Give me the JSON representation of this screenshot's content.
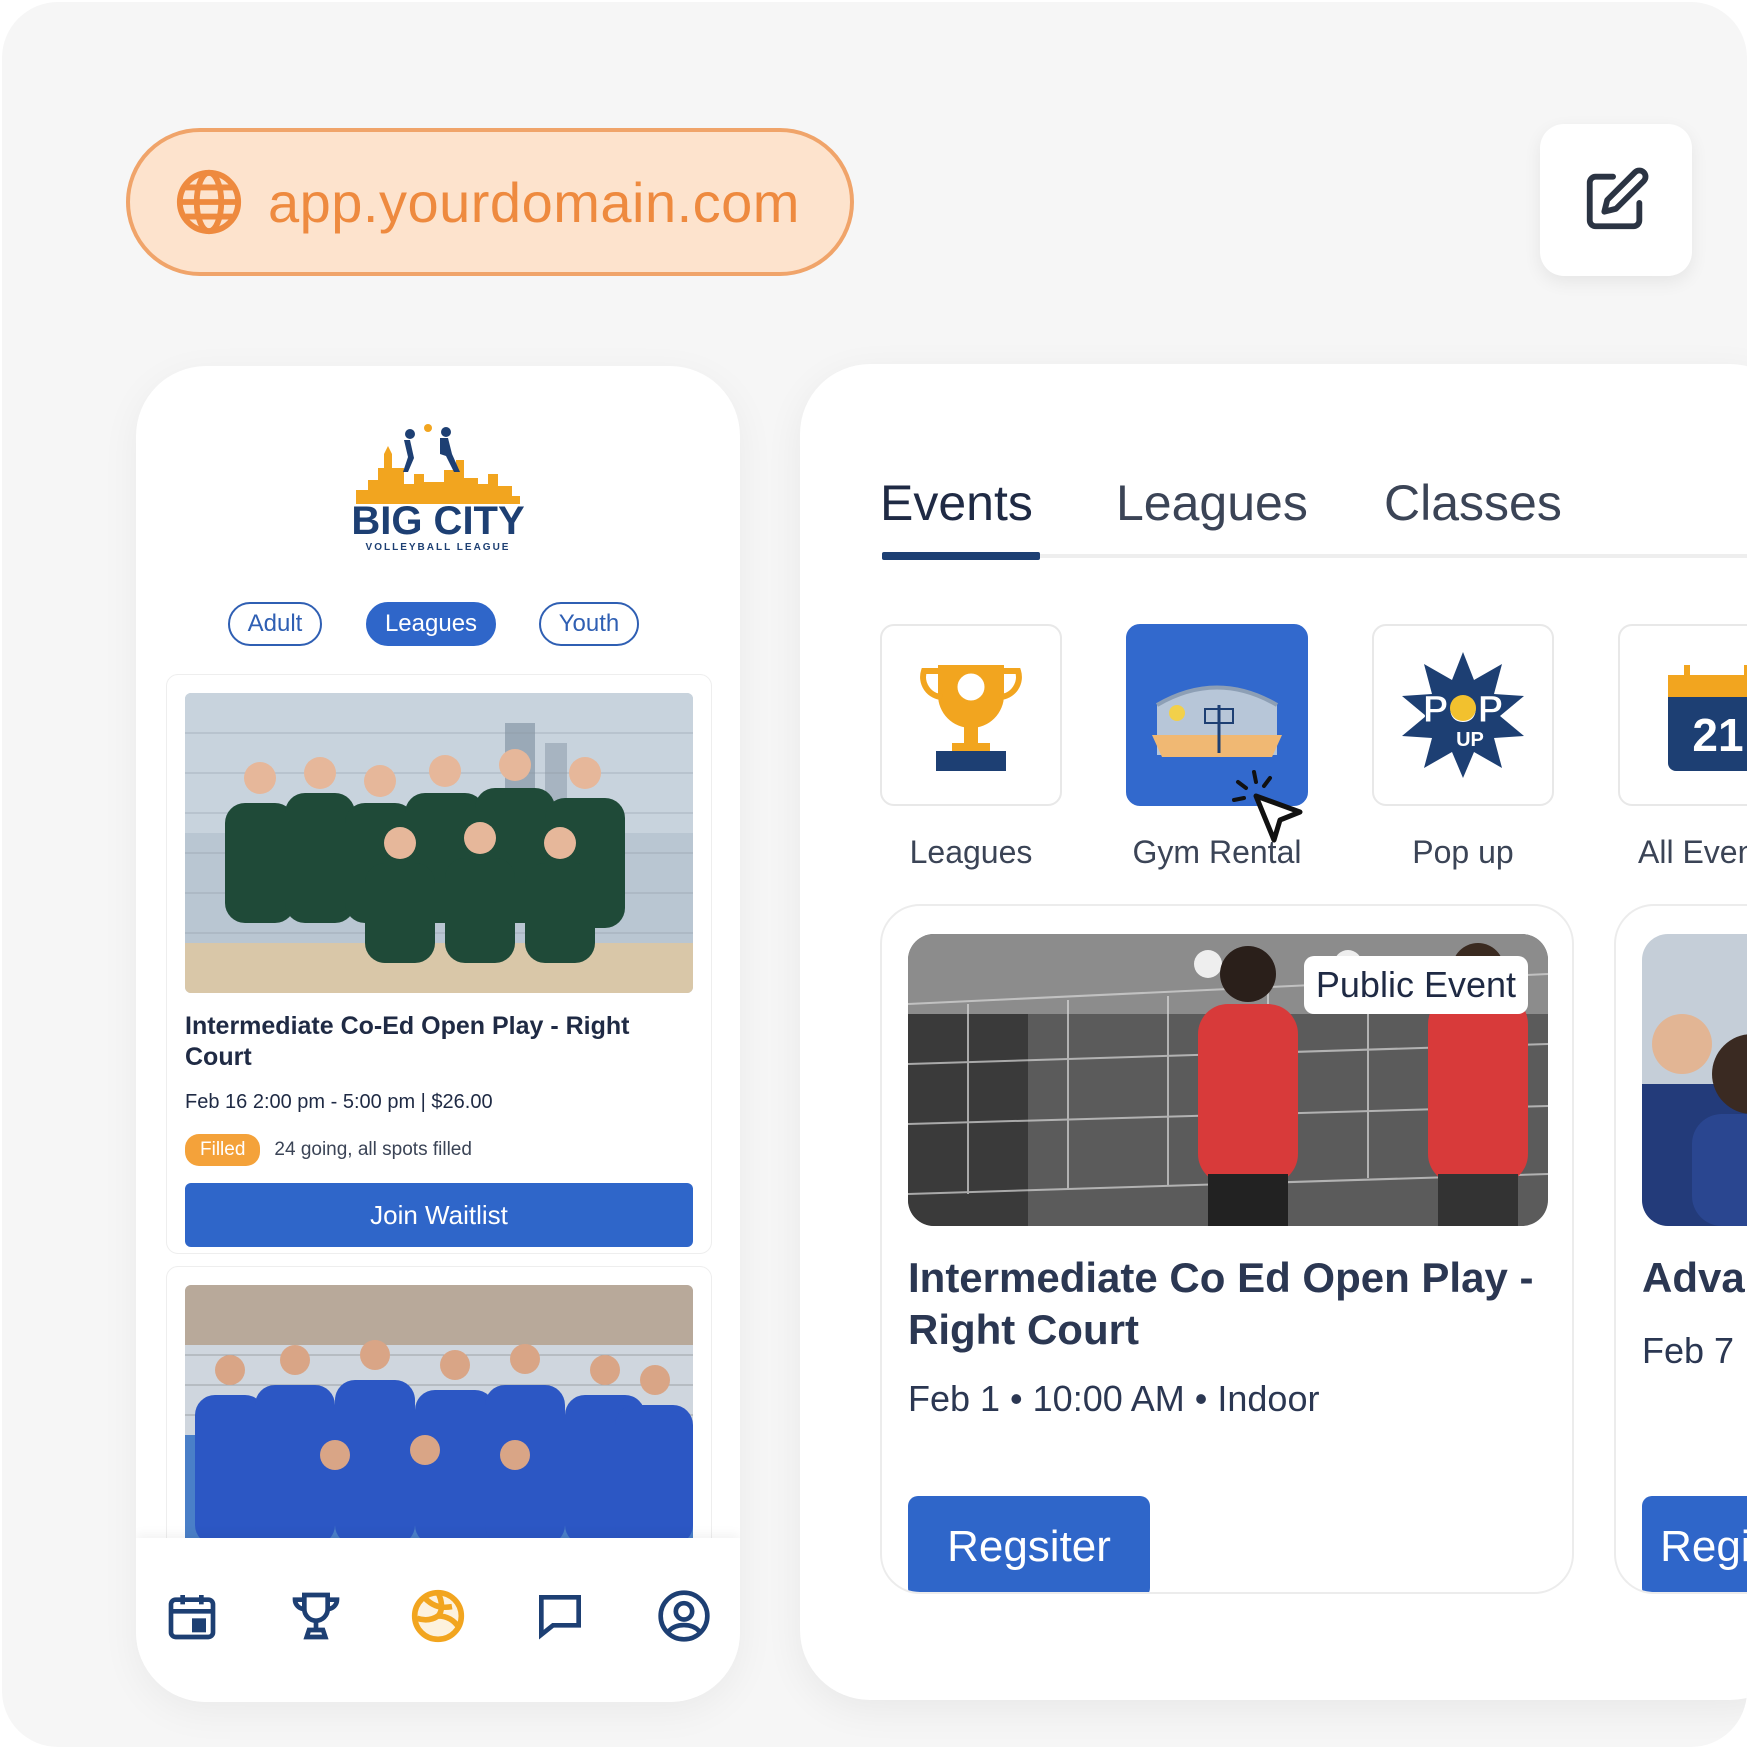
{
  "browser": {
    "url": "app.yourdomain.com"
  },
  "phone": {
    "logo": {
      "title": "BIG CITY",
      "subtitle": "VOLLEYBALL LEAGUE"
    },
    "chips": [
      {
        "label": "Adult",
        "active": false
      },
      {
        "label": "Leagues",
        "active": true
      },
      {
        "label": "Youth",
        "active": false
      }
    ],
    "event": {
      "title": "Intermediate Co-Ed Open Play - Right Court",
      "meta": "Feb 16 2:00 pm - 5:00 pm | $26.00",
      "badge": "Filled",
      "going": "24 going, all spots filled",
      "action": "Join Waitlist"
    },
    "tabbar": [
      "calendar-icon",
      "trophy-icon",
      "volleyball-icon",
      "chat-icon",
      "profile-icon"
    ]
  },
  "panel": {
    "tabs": [
      {
        "label": "Events",
        "active": true
      },
      {
        "label": "Leagues",
        "active": false
      },
      {
        "label": "Classes",
        "active": false
      }
    ],
    "categories": [
      {
        "label": "Leagues",
        "icon": "trophy-icon",
        "active": false
      },
      {
        "label": "Gym Rental",
        "icon": "gym-court-icon",
        "active": true
      },
      {
        "label": "Pop up",
        "icon": "popup-icon",
        "active": false
      },
      {
        "label": "All Events",
        "icon": "calendar-icon",
        "calendar_day": "21",
        "active": false
      }
    ],
    "cards": [
      {
        "badge": "Public Event",
        "title": "Intermediate Co Ed Open Play - Right Court",
        "meta": "Feb 1 • 10:00 AM •  Indoor",
        "action": "Regsiter"
      },
      {
        "title": "Advanced",
        "meta": "Feb 7",
        "action": "Register"
      }
    ]
  },
  "colors": {
    "primary": "#2f66c9",
    "navy": "#1d3f73",
    "orange": "#ee8a3f",
    "badge": "#f4a23a"
  }
}
